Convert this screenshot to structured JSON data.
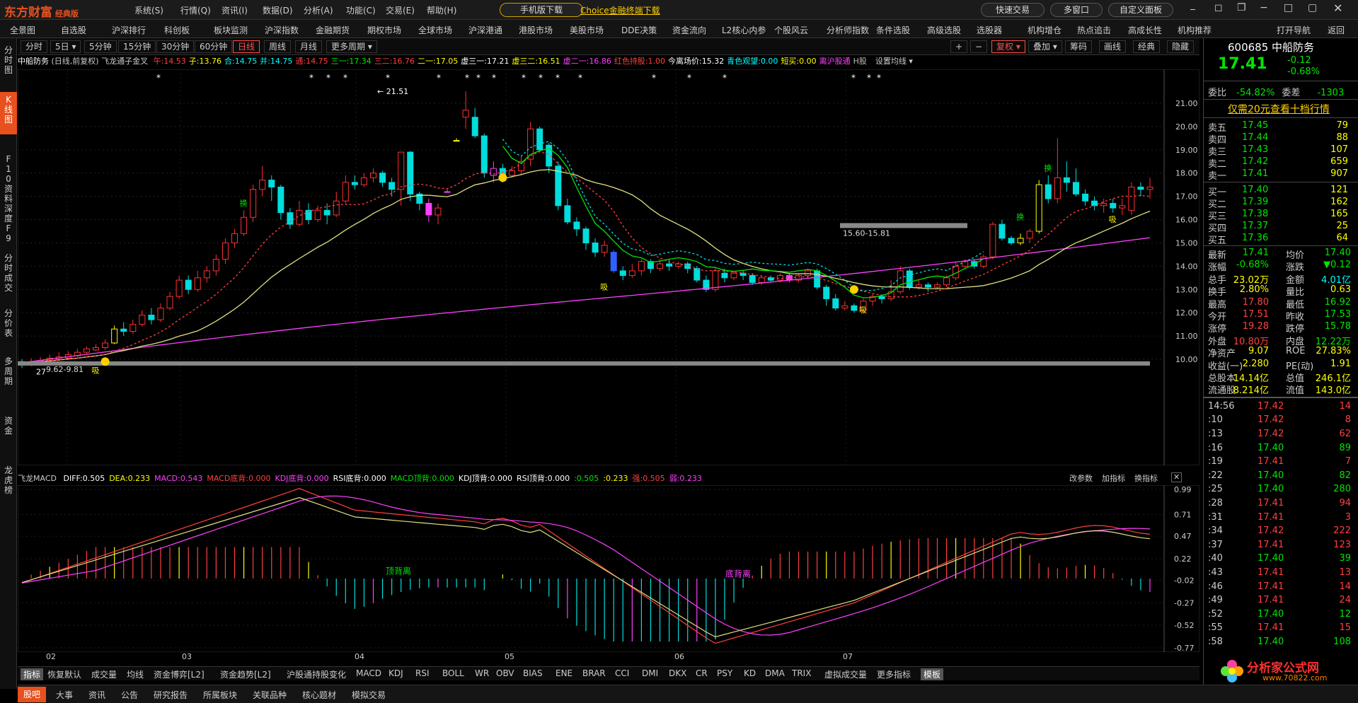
{
  "app": {
    "logo": "东方财富",
    "edition": "经典版",
    "menus": [
      "系统(S)",
      "行情(Q)",
      "资讯(I)",
      "数据(D)",
      "分析(A)",
      "功能(C)",
      "交易(E)",
      "帮助(H)"
    ],
    "promo_mobile": "手机版下载",
    "promo_choice": "Choice金融终端下载",
    "quick_trade": "快速交易",
    "multi_window": "多窗口",
    "custom_layout": "自定义面板"
  },
  "market_nav": [
    "全景图",
    "自选股",
    "沪深排行",
    "科创板",
    "板块监测",
    "沪深指数",
    "金融期货",
    "期权市场",
    "全球市场",
    "沪深港通",
    "港股市场",
    "美股市场",
    "DDE决策",
    "资金流向",
    "L2核心内参",
    "个股风云",
    "分析师指数",
    "条件选股",
    "高级选股",
    "选股器",
    "机构增仓",
    "热点追击",
    "高成长性",
    "机构推荐",
    "打开导航",
    "返回"
  ],
  "left_nav": [
    "分时图",
    "K线图",
    "F10资料",
    "深度F9",
    "分时成交",
    "分价表",
    "多周期",
    "资金",
    "龙虎榜"
  ],
  "periods": [
    "分时",
    "5日",
    "5分钟",
    "15分钟",
    "30分钟",
    "60分钟",
    "日线",
    "周线",
    "月线",
    "更多周期"
  ],
  "active_period": "日线",
  "toolbar_right": [
    "复权",
    "叠加",
    "筹码",
    "画线",
    "经典",
    "隐藏"
  ],
  "kline_indicator": {
    "stock": "中船防务",
    "mode": "(日线,前复权)",
    "name": "飞龙通子金叉",
    "items": [
      {
        "label": "午:14.53",
        "color": "#ff4040"
      },
      {
        "label": "子:13.76",
        "color": "#ffff00"
      },
      {
        "label": "合:14.75",
        "color": "#00ffff"
      },
      {
        "label": "并:14.75",
        "color": "#00ffff"
      },
      {
        "label": "通:14.75",
        "color": "#ff4040"
      },
      {
        "label": "三一:17.34",
        "color": "#00e600"
      },
      {
        "label": "三二:16.76",
        "color": "#ff4040"
      },
      {
        "label": "二一:17.05",
        "color": "#ffff00"
      },
      {
        "label": "虚三一:17.21",
        "color": "#ffffff"
      },
      {
        "label": "虚三二:16.51",
        "color": "#ffff00"
      },
      {
        "label": "虚二一:16.86",
        "color": "#ff40ff"
      },
      {
        "label": "红色持股:1.00",
        "color": "#ff4040"
      },
      {
        "label": "今离场价:15.32",
        "color": "#ffffff"
      },
      {
        "label": "青色观望:0.00",
        "color": "#00ffff"
      },
      {
        "label": "短买:0.00",
        "color": "#ffff00"
      },
      {
        "label": "离沪股通",
        "color": "#ff40ff"
      },
      {
        "label": "H股",
        "color": "#bbbbbb"
      }
    ],
    "settings": "设置均线"
  },
  "kline_axis": [
    "21.00",
    "20.00",
    "19.00",
    "18.00",
    "17.00",
    "16.00",
    "15.00",
    "14.00",
    "13.00",
    "12.00",
    "11.00",
    "10.00"
  ],
  "kline_labels": {
    "high": "21.51",
    "low_range": "9.62-9.81",
    "low": "27",
    "support": "15.60-15.81",
    "buy_mark": "吸",
    "sell_mark": "换"
  },
  "macd_indicator": {
    "name": "飞龙MACD",
    "items": [
      {
        "label": "DIFF:0.505",
        "color": "#ffffff"
      },
      {
        "label": "DEA:0.233",
        "color": "#ffff00"
      },
      {
        "label": "MACD:0.543",
        "color": "#ff40ff"
      },
      {
        "label": "MACD底背:0.000",
        "color": "#ff4040"
      },
      {
        "label": "KDJ底背:0.000",
        "color": "#ff40ff"
      },
      {
        "label": "RSI底背:0.000",
        "color": "#ffffff"
      },
      {
        "label": "MACD顶背:0.000",
        "color": "#00e600"
      },
      {
        "label": "KDJ顶背:0.000",
        "color": "#ffffff"
      },
      {
        "label": "RSI顶背:0.000",
        "color": "#ffffff"
      },
      {
        "label": ":0.505",
        "color": "#00e600"
      },
      {
        "label": ":0.233",
        "color": "#ffff00"
      },
      {
        "label": "强:0.505",
        "color": "#ff4040"
      },
      {
        "label": "弱:0.233",
        "color": "#ff40ff"
      }
    ],
    "actions": [
      "改参数",
      "加指标",
      "换指标"
    ],
    "top_div": "顶背离",
    "bottom_div": "底背离"
  },
  "macd_axis": [
    "0.99",
    "0.71",
    "0.47",
    "0.22",
    "-0.02",
    "-0.27",
    "-0.52",
    "-0.77"
  ],
  "x_axis": [
    "02",
    "03",
    "04",
    "05",
    "06",
    "07"
  ],
  "indicator_tabs": [
    "指标",
    "恢复默认",
    "成交量",
    "均线",
    "资金博弈[L2]",
    "资金趋势[L2]",
    "沪股通持股变化",
    "MACD",
    "KDJ",
    "RSI",
    "BOLL",
    "WR",
    "OBV",
    "BIAS",
    "ENE",
    "BRAR",
    "CCI",
    "DMI",
    "DKX",
    "CR",
    "PSY",
    "KD",
    "DMA",
    "TRIX",
    "虚拟成交量",
    "更多指标",
    "模板"
  ],
  "bottom_tabs": [
    "股吧",
    "大事",
    "资讯",
    "公告",
    "研究报告",
    "所属板块",
    "关联品种",
    "核心题材",
    "模拟交易"
  ],
  "quote": {
    "code": "600685",
    "name": "中船防务",
    "price": "17.41",
    "change": "-0.12",
    "pct": "-0.68%",
    "weibi_label": "委比",
    "weibi": "-54.82%",
    "weicha_label": "委差",
    "weicha": "-1303",
    "promo": "仅需20元查看十档行情",
    "asks": [
      [
        "卖五",
        "17.45",
        "79"
      ],
      [
        "卖四",
        "17.44",
        "88"
      ],
      [
        "卖三",
        "17.43",
        "107"
      ],
      [
        "卖二",
        "17.42",
        "659"
      ],
      [
        "卖一",
        "17.41",
        "907"
      ]
    ],
    "bids": [
      [
        "买一",
        "17.40",
        "121"
      ],
      [
        "买二",
        "17.39",
        "162"
      ],
      [
        "买三",
        "17.38",
        "165"
      ],
      [
        "买四",
        "17.37",
        "25"
      ],
      [
        "买五",
        "17.36",
        "64"
      ]
    ],
    "stats": [
      [
        "最新",
        "17.41",
        "均价",
        "17.40"
      ],
      [
        "涨幅",
        "-0.68%",
        "涨跌",
        "▼0.12"
      ],
      [
        "总手",
        "23.02万",
        "金额",
        "4.01亿"
      ],
      [
        "换手",
        "2.80%",
        "量比",
        "0.63"
      ],
      [
        "最高",
        "17.80",
        "最低",
        "16.92"
      ],
      [
        "今开",
        "17.51",
        "昨收",
        "17.53"
      ],
      [
        "涨停",
        "19.28",
        "跌停",
        "15.78"
      ],
      [
        "外盘",
        "10.80万",
        "内盘",
        "12.22万"
      ],
      [
        "净资产",
        "9.07",
        "ROE",
        "27.83%"
      ],
      [
        "收益(一)",
        "2.280",
        "PE(动)",
        "1.91"
      ],
      [
        "总股本",
        "14.14亿",
        "总值",
        "246.1亿"
      ],
      [
        "流通股",
        "8.214亿",
        "流值",
        "143.0亿"
      ]
    ]
  },
  "ticks": [
    [
      "14:56",
      "17.42",
      "14"
    ],
    [
      ":10",
      "17.42",
      "8"
    ],
    [
      ":13",
      "17.42",
      "62"
    ],
    [
      ":16",
      "17.40",
      "89"
    ],
    [
      ":19",
      "17.41",
      "7"
    ],
    [
      ":22",
      "17.40",
      "82"
    ],
    [
      ":25",
      "17.40",
      "280"
    ],
    [
      ":28",
      "17.41",
      "94"
    ],
    [
      ":31",
      "17.41",
      "3"
    ],
    [
      ":34",
      "17.42",
      "222"
    ],
    [
      ":37",
      "17.41",
      "123"
    ],
    [
      ":40",
      "17.40",
      "39"
    ],
    [
      ":43",
      "17.41",
      "13"
    ],
    [
      ":46",
      "17.41",
      "14"
    ],
    [
      ":49",
      "17.41",
      "24"
    ],
    [
      ":52",
      "17.40",
      "12"
    ],
    [
      ":55",
      "17.41",
      "15"
    ],
    [
      ":58",
      "17.40",
      "108"
    ]
  ],
  "watermark": {
    "text": "分析家公式网",
    "url": "www.70822.com"
  },
  "colors": {
    "up": "#ff4040",
    "down": "#00e600",
    "accent": "#e8501e",
    "ma_magenta": "#ff40ff",
    "ma_yellow": "#ffff00"
  }
}
